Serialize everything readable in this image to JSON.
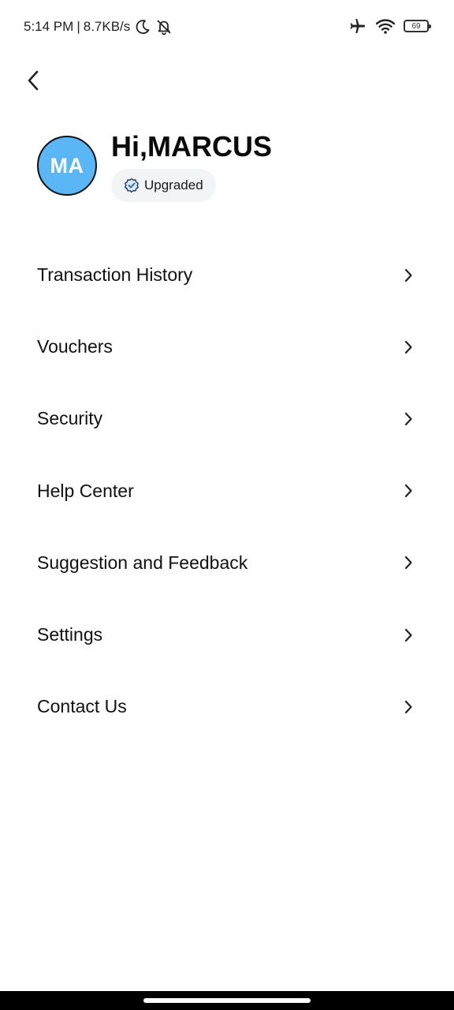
{
  "status_bar": {
    "time": "5:14 PM",
    "separator": "|",
    "network_speed": "8.7KB/s",
    "battery_level": "69",
    "icons": [
      "moon-icon",
      "bell-off-icon",
      "airplane-icon",
      "wifi-icon",
      "battery-icon"
    ]
  },
  "header": {
    "back_icon": "chevron-left-icon"
  },
  "profile": {
    "avatar_initials": "MA",
    "avatar_color": "#5bb6f5",
    "greeting_prefix": "Hi,",
    "name": "MARCUS",
    "badge_label": "Upgraded",
    "badge_icon": "verified-badge-icon",
    "badge_icon_color": "#2f6fb7"
  },
  "menu": {
    "items": [
      {
        "label": "Transaction History"
      },
      {
        "label": "Vouchers"
      },
      {
        "label": "Security"
      },
      {
        "label": "Help Center"
      },
      {
        "label": "Suggestion and Feedback"
      },
      {
        "label": "Settings"
      },
      {
        "label": "Contact Us"
      }
    ],
    "chevron_icon": "chevron-right-icon"
  }
}
